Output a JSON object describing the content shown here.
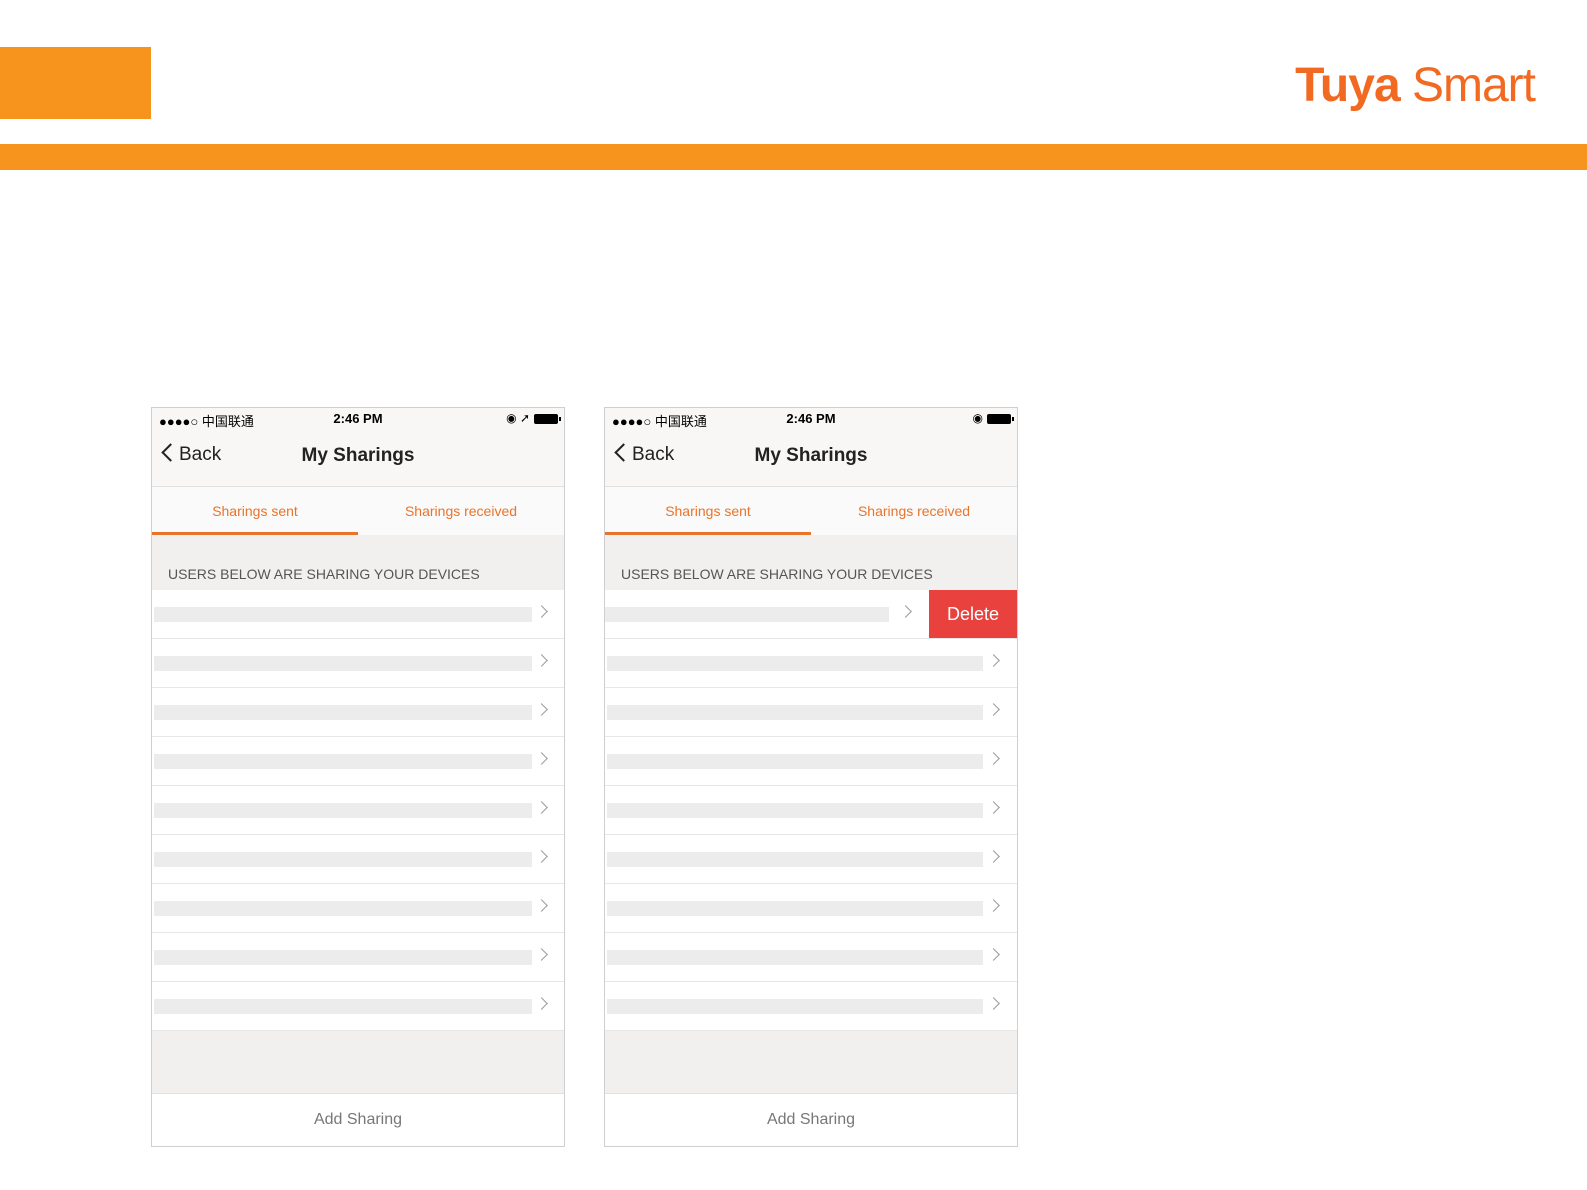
{
  "slide": {
    "brand": {
      "part1": "Tuya",
      "part2": "Smart"
    },
    "colors": {
      "accent": "#f7941d",
      "brand": "#f26a21",
      "tab": "#e8732a",
      "delete": "#e9423e"
    }
  },
  "phone_left": {
    "status": {
      "carrier": "●●●●○ 中国联通 ",
      "wifi_icon": "wifi-icon",
      "time": "2:46 PM",
      "icons": "◉ ➚"
    },
    "nav": {
      "back": "Back",
      "title": "My Sharings"
    },
    "tabs": {
      "sent": "Sharings sent",
      "received": "Sharings received",
      "active": "sent"
    },
    "section_header": "USERS BELOW ARE SHARING YOUR DEVICES",
    "rows_count_note": "",
    "footer": "Add Sharing"
  },
  "phone_right": {
    "status": {
      "carrier": "●●●●○ 中国联通 ",
      "wifi_icon": "wifi-icon",
      "time": "2:46 PM",
      "icons": "◉"
    },
    "nav": {
      "back": "Back",
      "title": "My Sharings"
    },
    "tabs": {
      "sent": "Sharings sent",
      "received": "Sharings received",
      "active": "sent"
    },
    "section_header": "USERS BELOW ARE SHARING YOUR DEVICES",
    "delete_label": "Delete",
    "footer": "Add Sharing"
  }
}
